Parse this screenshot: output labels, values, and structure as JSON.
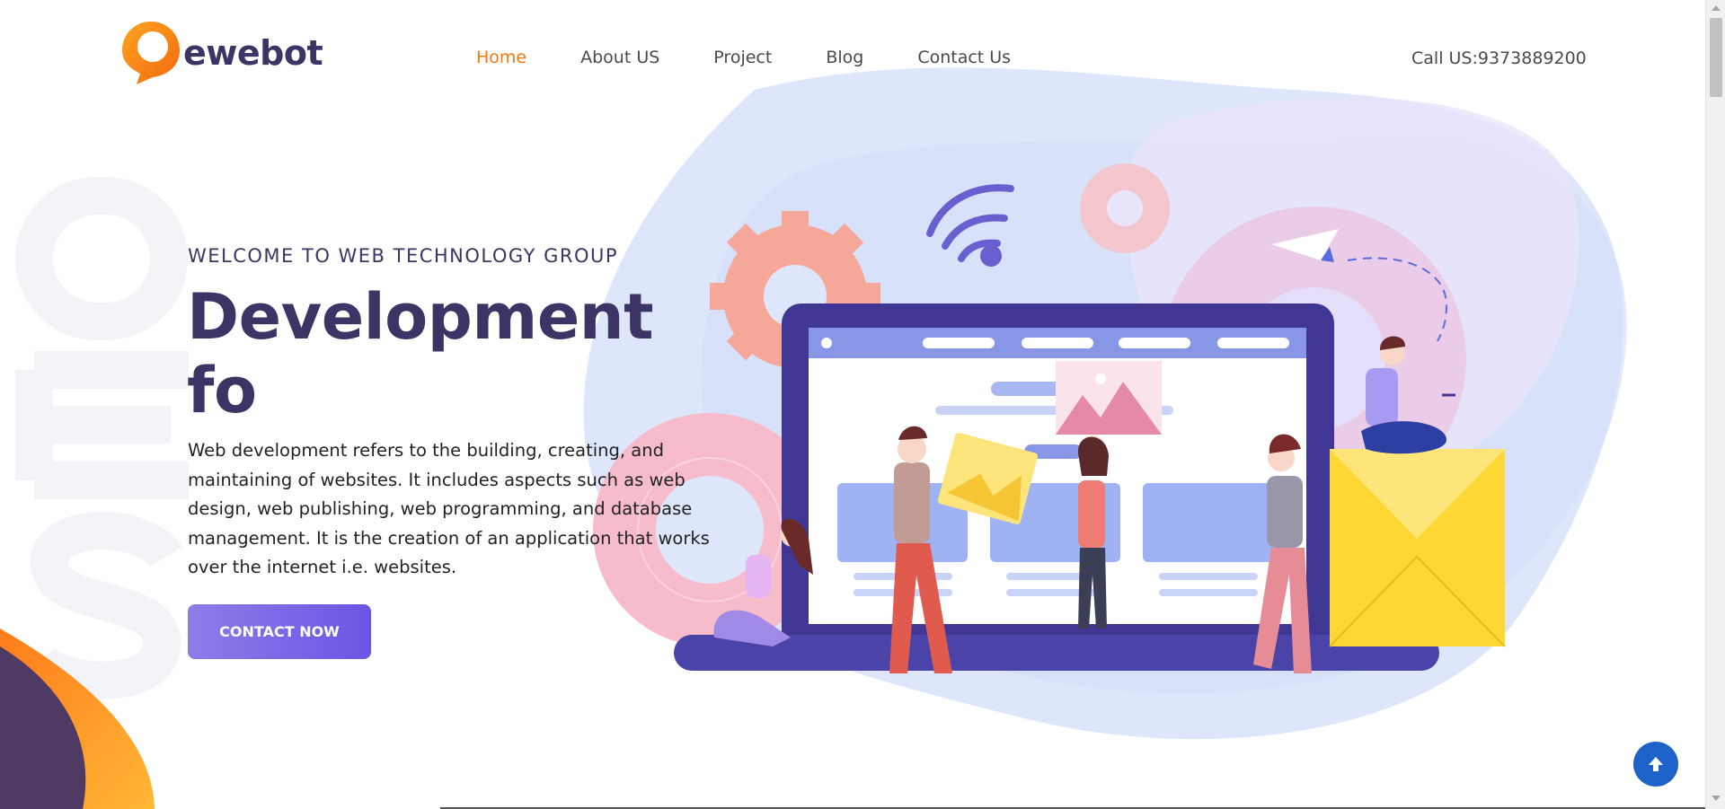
{
  "header": {
    "brand": "ewebot",
    "nav": [
      {
        "label": "Home",
        "active": true
      },
      {
        "label": "About US",
        "active": false
      },
      {
        "label": "Project",
        "active": false
      },
      {
        "label": "Blog",
        "active": false
      },
      {
        "label": "Contact Us",
        "active": false
      }
    ],
    "call": "Call US:9373889200"
  },
  "hero": {
    "subtitle": "WELCOME TO WEB TECHNOLOGY GROUP",
    "title": "Development fo",
    "description": "Web development refers to the building, creating, and maintaining of websites. It includes aspects such as web design, web publishing, web programming, and database management. It is the creation of an application that works over the internet i.e. websites.",
    "cta_label": "CONTACT NOW",
    "watermark": "SEO"
  },
  "colors": {
    "brand_dark": "#3d3466",
    "accent_orange": "#f07a12",
    "button_start": "#8d7de8",
    "button_end": "#6a55e4",
    "scroll_top": "#1d62c9"
  },
  "icons": {
    "scroll_top": "arrow-up-icon",
    "logo": "speech-bubble-icon"
  }
}
